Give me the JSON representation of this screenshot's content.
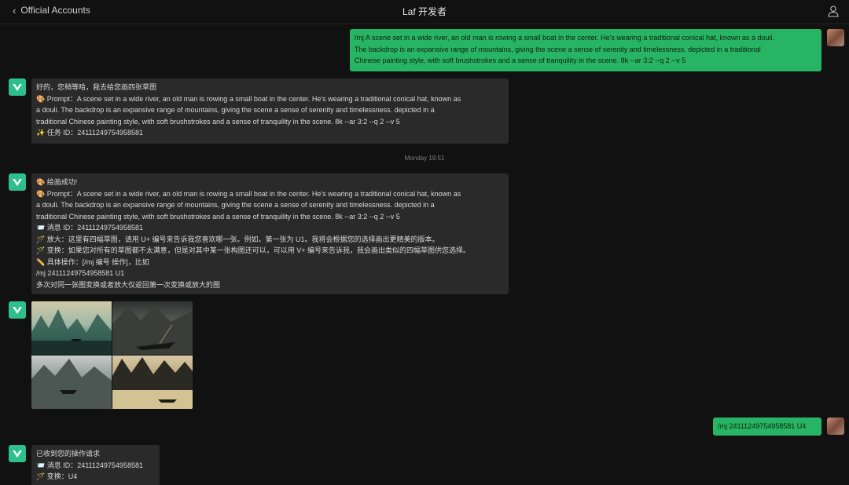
{
  "header": {
    "back_label": "Official Accounts",
    "title": "Laf 开发者"
  },
  "messages": {
    "user_prompt": {
      "lines": [
        "/mj A scene set in a wide river, an old man is rowing a small boat in the center. He's wearing a traditional conical hat, known as a douli.",
        "The backdrop is an expansive range of mountains, giving the scene a sense of serenity and timelessness. depicted in a traditional",
        "Chinese painting style, with soft brushstrokes and a sense of tranquility in the scene. 8k --ar 3:2 --q 2 --v 5"
      ]
    },
    "bot_ack": {
      "lines": [
        "好的，您稍等哈，我去给您画四张草图",
        "🎨 Prompt：A scene set in a wide river, an old man is rowing a small boat in the center. He's wearing a traditional conical hat, known as",
        "a douli. The backdrop is an expansive range of mountains, giving the scene a sense of serenity and timelessness. depicted in a",
        "traditional Chinese painting style, with soft brushstrokes and a sense of tranquility in the scene. 8k --ar 3:2 --q 2 --v 5",
        "✨ 任务 ID：24111249754958581"
      ]
    },
    "timestamp": "Monday 19:51",
    "bot_success": {
      "lines": [
        "🎨 绘画成功!",
        "🎨 Prompt：A scene set in a wide river, an old man is rowing a small boat in the center. He's wearing a traditional conical hat, known as",
        "a douli. The backdrop is an expansive range of mountains, giving the scene a sense of serenity and timelessness. depicted in a",
        "traditional Chinese painting style, with soft brushstrokes and a sense of tranquility in the scene. 8k --ar 3:2 --q 2 --v 5",
        "📨 消息 ID：24111249754958581",
        "🪄 放大：这里有四幅草图，请用 U+ 编号来告诉我您喜欢哪一张。例如，第一张为 U1。我将会根据您的选择画出更精美的版本。",
        "🪄 变换：如果您对所有的草图都不太满意，但是对其中某一张构图还可以，可以用 V+ 编号来告诉我，我会画出类似的四幅草图供您选择。",
        "✏️ 具体操作：[/mj 编号 操作]，比如",
        "/mj 24111249754958581 U1",
        "多次对同一张图变换或者放大仅返回第一次变换或放大的图"
      ]
    },
    "user_u4": {
      "text": "/mj 24111249754958581 U4"
    },
    "bot_received": {
      "lines": [
        "已收到您的操作请求",
        "📨 消息 ID：24111249754958581",
        "🪄 变换：U4"
      ]
    }
  },
  "icons": {
    "back": "chevron-left-icon",
    "profile": "user-profile-icon",
    "bot_avatar": "laf-logo-icon"
  },
  "colors": {
    "background": "#111111",
    "bot_bubble": "#2a2a2a",
    "user_bubble": "#27b464",
    "bot_avatar": "#2ec08c"
  }
}
